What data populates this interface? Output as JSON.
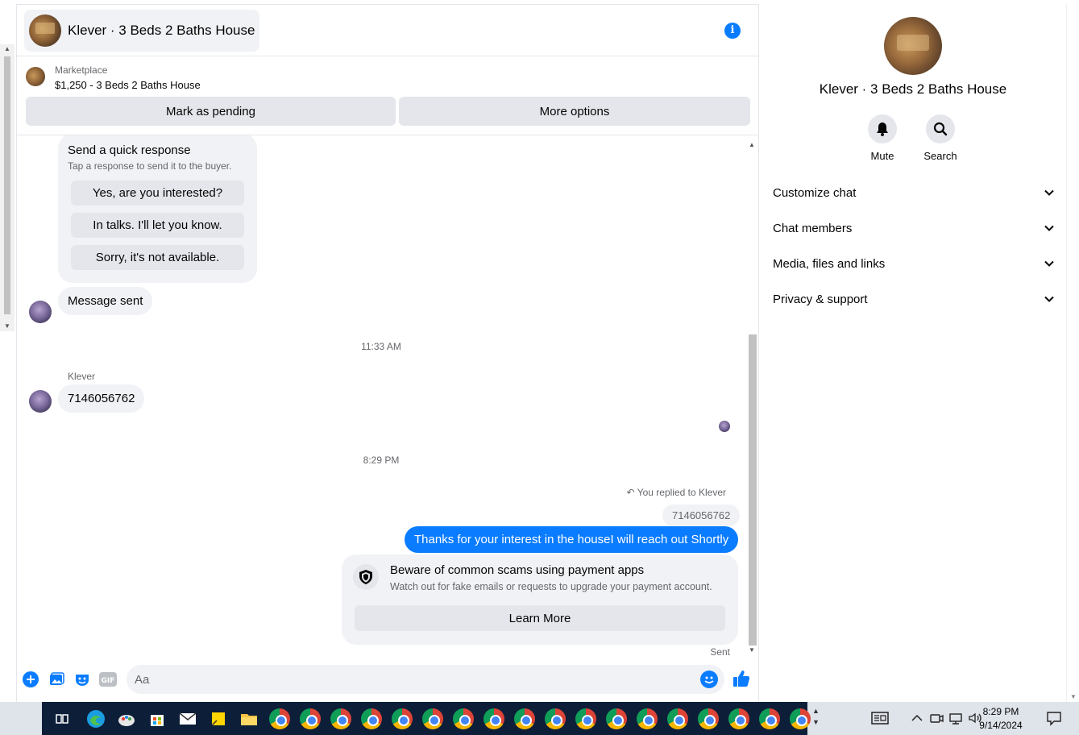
{
  "header": {
    "title": "Klever · 3 Beds 2 Baths House",
    "info_icon": "info-icon"
  },
  "listing": {
    "source": "Marketplace",
    "price_title": "$1,250 - 3 Beds 2 Baths House",
    "mark_pending": "Mark as pending",
    "more_options": "More options"
  },
  "quick_response": {
    "title": "Send a quick response",
    "subtitle": "Tap a response to send it to the buyer.",
    "options": [
      "Yes, are you interested?",
      "In talks. I'll let you know.",
      "Sorry, it's not available."
    ]
  },
  "messages": {
    "sent_note": "Message sent",
    "time1": "11:33 AM",
    "sender": "Klever",
    "phone_msg": "7146056762",
    "time2": "8:29 PM",
    "reply_note": "You replied to Klever",
    "reply_quote": "7146056762",
    "outgoing": "Thanks for your interest in the houseI will reach out Shortly",
    "status": "Sent"
  },
  "scam_card": {
    "title": "Beware of common scams using payment apps",
    "subtitle": "Watch out for fake emails or requests to upgrade your payment account.",
    "button": "Learn More"
  },
  "composer": {
    "placeholder": "Aa"
  },
  "side": {
    "name": "Klever · 3 Beds 2 Baths House",
    "mute": "Mute",
    "search": "Search",
    "sections": [
      "Customize chat",
      "Chat members",
      "Media, files and links",
      "Privacy & support"
    ]
  },
  "taskbar": {
    "time": "8:29 PM",
    "date": "9/14/2024"
  },
  "colors": {
    "accent": "#0a7cff",
    "bubble": "#f0f2f5",
    "button": "#e4e6eb",
    "taskbar": "#0d1e38"
  }
}
